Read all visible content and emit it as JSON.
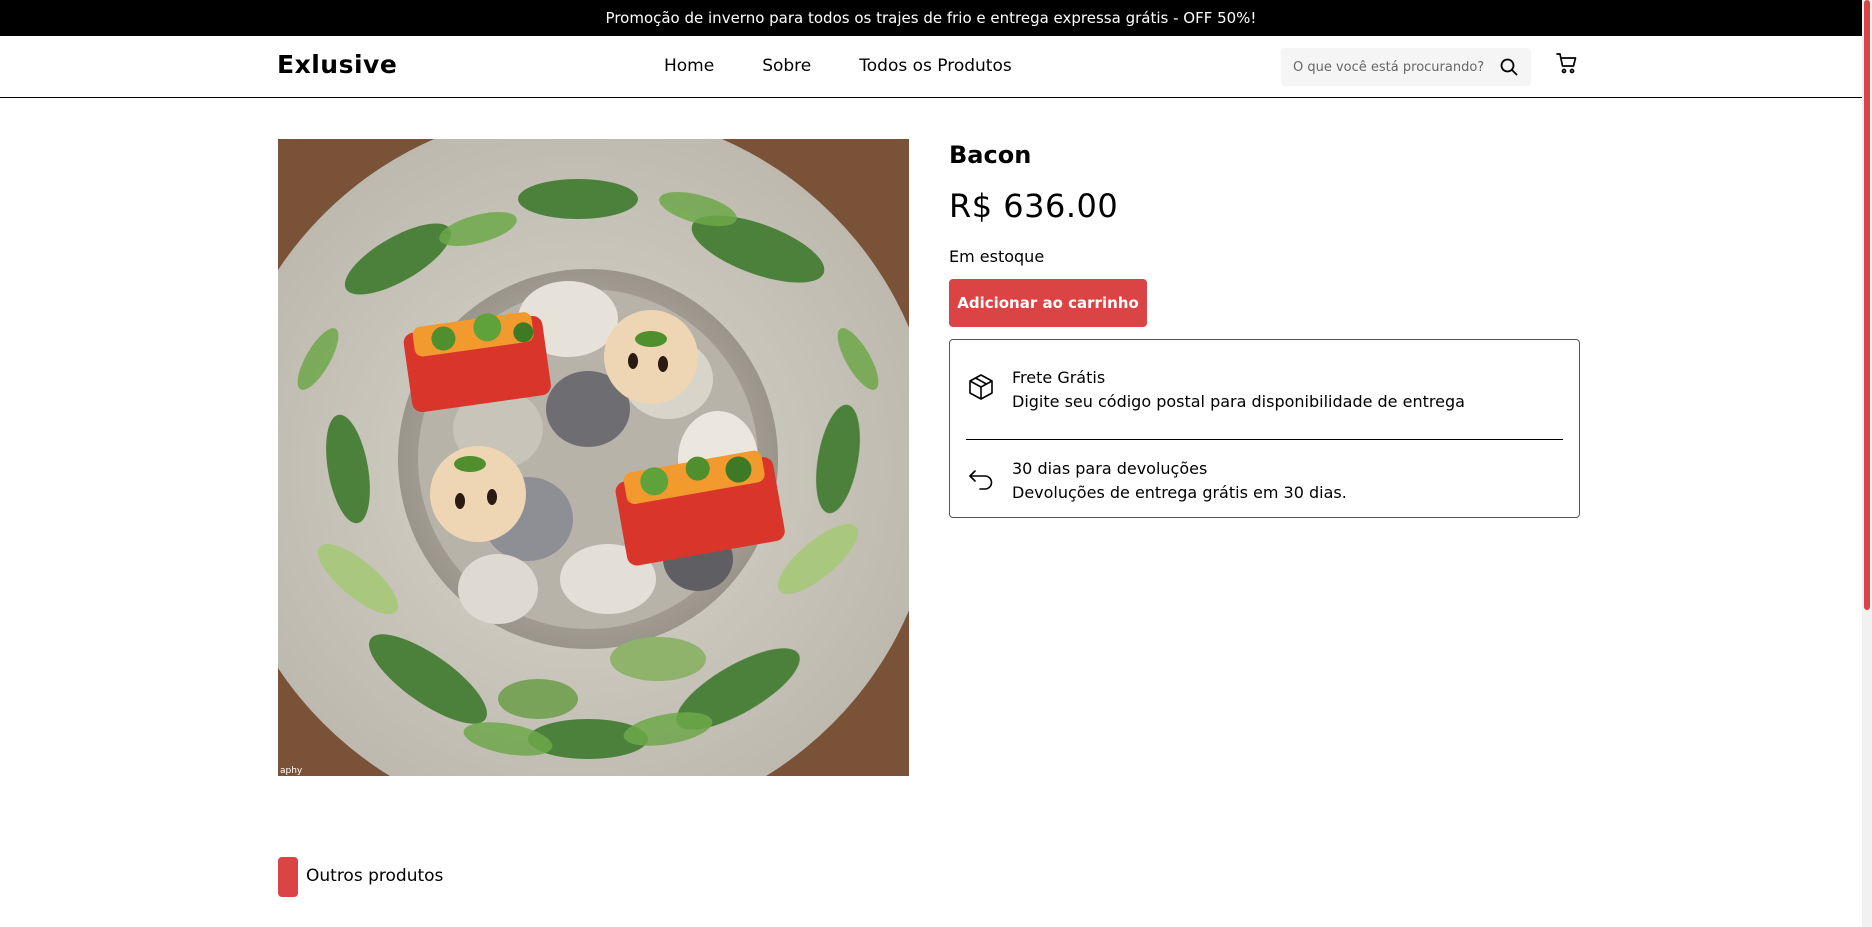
{
  "promo": {
    "text": "Promoção de inverno para todos os trajes de frio e entrega expressa grátis - OFF 50%!"
  },
  "header": {
    "logo": "Exlusive",
    "nav": [
      "Home",
      "Sobre",
      "Todos os Produtos"
    ],
    "search": {
      "placeholder": "O que você está procurando?",
      "value": ""
    }
  },
  "icons": {
    "search": "search-icon",
    "cart": "cart-icon",
    "package": "package-icon",
    "return": "return-arrow-icon"
  },
  "product": {
    "title": "Bacon",
    "price": "R$ 636.00",
    "stock": "Em estoque",
    "add_to_cart": "Adicionar ao carrinho",
    "image_credit": "aphy"
  },
  "delivery": {
    "title": "Frete Grátis",
    "desc": "Digite seu código postal para disponibilidade de entrega"
  },
  "returns": {
    "title": "30 dias para devoluções",
    "desc": "Devoluções de entrega grátis em 30 dias."
  },
  "section": {
    "label": "Outros produtos"
  },
  "colors": {
    "accent": "#DB4444",
    "promo_bg": "#000000",
    "search_bg": "#F5F5F5"
  }
}
